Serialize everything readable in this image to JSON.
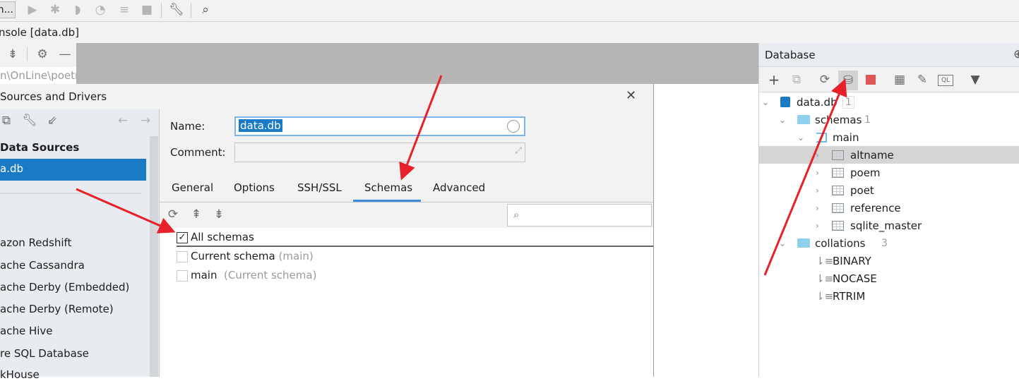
{
  "topbar": {
    "run_config_label": "n...",
    "icons": [
      "run-icon",
      "debug-icon",
      "coverage-icon",
      "profile-icon",
      "run-list-icon",
      "stop-icon",
      "wrench-icon",
      "search-icon"
    ]
  },
  "console_title": "nsole [data.db]",
  "left_mini": {
    "path": "n\\OnLine\\poetr"
  },
  "dialog": {
    "title": "Sources and Drivers",
    "section_header": "Data Sources",
    "selected_source": "a.db",
    "drivers": [
      "azon Redshift",
      "ache Cassandra",
      "ache Derby (Embedded)",
      "ache Derby (Remote)",
      "ache Hive",
      "re SQL Database",
      "kHouse"
    ],
    "name_label": "Name:",
    "name_value": "data.db",
    "comment_label": "Comment:",
    "comment_value": "",
    "tabs": [
      {
        "label": "General"
      },
      {
        "label": "Options"
      },
      {
        "label": "SSH/SSL"
      },
      {
        "label": "Schemas",
        "active": true
      },
      {
        "label": "Advanced"
      }
    ],
    "search_placeholder": "",
    "schemas": [
      {
        "label": "All schemas",
        "hint": "",
        "checked": true
      },
      {
        "label": "Current schema",
        "hint": "(main)",
        "checked": false
      },
      {
        "label": "main",
        "hint": "(Current schema)",
        "checked": false
      }
    ],
    "close": "✕"
  },
  "database_panel": {
    "title": "Database",
    "tree": {
      "root": {
        "label": "data.db",
        "count": "1"
      },
      "schemas": {
        "label": "schemas",
        "count": "1"
      },
      "main": {
        "label": "main"
      },
      "tables": [
        "altname",
        "poem",
        "poet",
        "reference",
        "sqlite_master"
      ],
      "collations": {
        "label": "collations",
        "count": "3"
      },
      "collation_items": [
        "BINARY",
        "NOCASE",
        "RTRIM"
      ]
    }
  },
  "colors": {
    "accent": "#1b7ac4",
    "annotation": "#e8202a",
    "stop": "#e05555"
  }
}
